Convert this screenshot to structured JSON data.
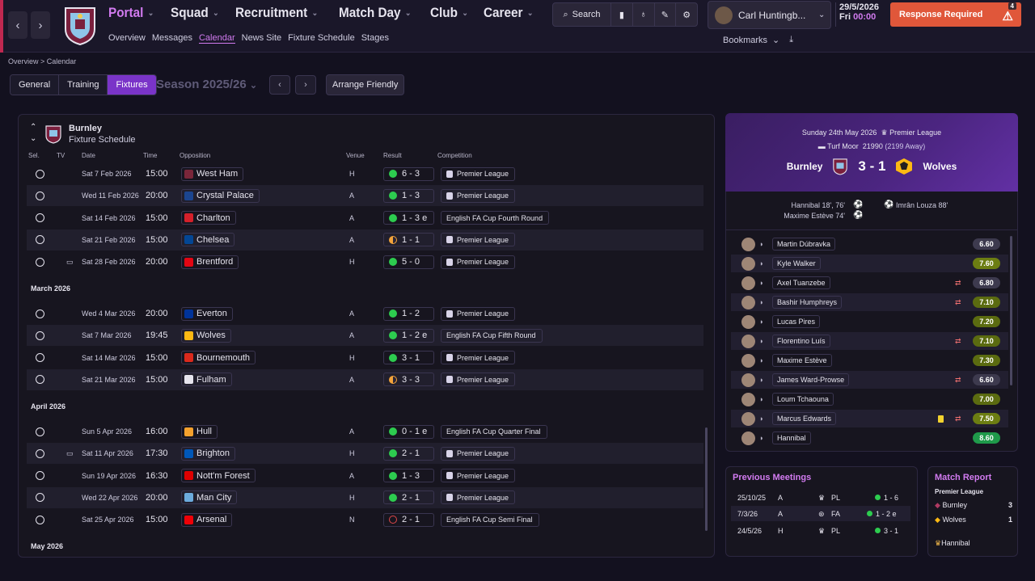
{
  "nav": {
    "back": "‹",
    "forward": "›"
  },
  "menu": [
    {
      "label": "Portal",
      "active": true
    },
    {
      "label": "Squad"
    },
    {
      "label": "Recruitment"
    },
    {
      "label": "Match Day"
    },
    {
      "label": "Club"
    },
    {
      "label": "Career"
    }
  ],
  "submenu": [
    "Overview",
    "Messages",
    "Calendar",
    "News Site",
    "Fixture Schedule",
    "Stages"
  ],
  "search": {
    "label": "Search"
  },
  "manager": {
    "name": "Carl Huntingb..."
  },
  "game_date": {
    "date": "29/5/2026",
    "day": "Fri",
    "time": "00:00"
  },
  "response": {
    "label": "Response Required",
    "count": "4"
  },
  "bookmarks": {
    "label": "Bookmarks"
  },
  "breadcrumb": "Overview  >  Calendar",
  "tabs": [
    "General",
    "Training",
    "Fixtures"
  ],
  "season": "Season 2025/26",
  "arrange_friendly": "Arrange Friendly",
  "schedule": {
    "team": "Burnley",
    "subtitle": "Fixture Schedule",
    "columns": {
      "sel": "Sel.",
      "tv": "TV",
      "date": "Date",
      "time": "Time",
      "opposition": "Opposition",
      "venue": "Venue",
      "result": "Result",
      "competition": "Competition"
    },
    "months": {
      "march": "March 2026",
      "april": "April 2026",
      "may": "May 2026"
    },
    "feb": [
      {
        "date": "Sat 7 Feb 2026",
        "time": "15:00",
        "opp": "West Ham",
        "badge": "#7a263a",
        "venue": "H",
        "result": "6 - 3",
        "dot": "win",
        "comp": "Premier League",
        "tv": ""
      },
      {
        "date": "Wed 11 Feb 2026",
        "time": "20:00",
        "opp": "Crystal Palace",
        "badge": "#1b458f",
        "venue": "A",
        "result": "1 - 3",
        "dot": "win",
        "comp": "Premier League",
        "tv": ""
      },
      {
        "date": "Sat 14 Feb 2026",
        "time": "15:00",
        "opp": "Charlton",
        "badge": "#d4202a",
        "venue": "A",
        "result": "1 - 3 e",
        "dot": "win",
        "comp": "English FA Cup Fourth Round",
        "tv": ""
      },
      {
        "date": "Sat 21 Feb 2026",
        "time": "15:00",
        "opp": "Chelsea",
        "badge": "#034694",
        "venue": "A",
        "result": "1 - 1",
        "dot": "draw",
        "comp": "Premier League",
        "tv": ""
      },
      {
        "date": "Sat 28 Feb 2026",
        "time": "20:00",
        "opp": "Brentford",
        "badge": "#e30613",
        "venue": "H",
        "result": "5 - 0",
        "dot": "win",
        "comp": "Premier League",
        "tv": "tv"
      }
    ],
    "mar": [
      {
        "date": "Wed 4 Mar 2026",
        "time": "20:00",
        "opp": "Everton",
        "badge": "#003399",
        "venue": "A",
        "result": "1 - 2",
        "dot": "win",
        "comp": "Premier League",
        "tv": ""
      },
      {
        "date": "Sat 7 Mar 2026",
        "time": "19:45",
        "opp": "Wolves",
        "badge": "#fdb913",
        "venue": "A",
        "result": "1 - 2 e",
        "dot": "win",
        "comp": "English FA Cup Fifth Round",
        "tv": ""
      },
      {
        "date": "Sat 14 Mar 2026",
        "time": "15:00",
        "opp": "Bournemouth",
        "badge": "#da291c",
        "venue": "H",
        "result": "3 - 1",
        "dot": "win",
        "comp": "Premier League",
        "tv": ""
      },
      {
        "date": "Sat 21 Mar 2026",
        "time": "15:00",
        "opp": "Fulham",
        "badge": "#e6e4ee",
        "venue": "A",
        "result": "3 - 3",
        "dot": "draw",
        "comp": "Premier League",
        "tv": ""
      }
    ],
    "apr": [
      {
        "date": "Sun 5 Apr 2026",
        "time": "16:00",
        "opp": "Hull",
        "badge": "#f5a12d",
        "venue": "A",
        "result": "0 - 1 e",
        "dot": "win",
        "comp": "English FA Cup Quarter Final",
        "tv": ""
      },
      {
        "date": "Sat 11 Apr 2026",
        "time": "17:30",
        "opp": "Brighton",
        "badge": "#0057b8",
        "venue": "H",
        "result": "2 - 1",
        "dot": "win",
        "comp": "Premier League",
        "tv": "tv"
      },
      {
        "date": "Sun 19 Apr 2026",
        "time": "16:30",
        "opp": "Nott'm Forest",
        "badge": "#dd0000",
        "venue": "A",
        "result": "1 - 3",
        "dot": "win",
        "comp": "Premier League",
        "tv": ""
      },
      {
        "date": "Wed 22 Apr 2026",
        "time": "20:00",
        "opp": "Man City",
        "badge": "#6cabdd",
        "venue": "H",
        "result": "2 - 1",
        "dot": "win",
        "comp": "Premier League",
        "tv": ""
      },
      {
        "date": "Sat 25 Apr 2026",
        "time": "15:00",
        "opp": "Arsenal",
        "badge": "#ef0107",
        "venue": "N",
        "result": "2 - 1",
        "dot": "loss",
        "comp": "English FA Cup Semi Final",
        "tv": ""
      }
    ]
  },
  "match": {
    "date": "Sunday 24th May 2026",
    "competition": "Premier League",
    "stadium": "Turf Moor",
    "attendance": "21990",
    "away_att": "(2199 Away)",
    "home": "Burnley",
    "away": "Wolves",
    "score": "3 - 1",
    "home_scorers": [
      "Hannibal 18', 76'",
      "Maxime Estève 74'"
    ],
    "away_scorers": [
      "Imrân Louza 88'"
    ]
  },
  "lineup": [
    {
      "name": "Martin Dúbravka",
      "rating": "6.60",
      "color": "#3d3a4e",
      "sub": "",
      "card": false
    },
    {
      "name": "Kyle Walker",
      "rating": "7.60",
      "color": "#6c7d12",
      "sub": "",
      "card": false
    },
    {
      "name": "Axel Tuanzebe",
      "rating": "6.80",
      "color": "#3d3a4e",
      "sub": "⇄",
      "card": false
    },
    {
      "name": "Bashir Humphreys",
      "rating": "7.10",
      "color": "#5b6b10",
      "sub": "⇄",
      "card": false
    },
    {
      "name": "Lucas Pires",
      "rating": "7.20",
      "color": "#5b6b10",
      "sub": "",
      "card": false
    },
    {
      "name": "Florentino Luís",
      "rating": "7.10",
      "color": "#5b6b10",
      "sub": "⇄",
      "card": false
    },
    {
      "name": "Maxime Estève",
      "rating": "7.30",
      "color": "#5b6b10",
      "sub": "",
      "card": false
    },
    {
      "name": "James Ward-Prowse",
      "rating": "6.60",
      "color": "#3d3a4e",
      "sub": "⇄",
      "card": false
    },
    {
      "name": "Loum Tchaouna",
      "rating": "7.00",
      "color": "#5b6b10",
      "sub": "",
      "card": false
    },
    {
      "name": "Marcus Edwards",
      "rating": "7.50",
      "color": "#6c7d12",
      "sub": "⇄",
      "card": true
    },
    {
      "name": "Hannibal",
      "rating": "8.60",
      "color": "#1f9a4a",
      "sub": "",
      "card": false
    }
  ],
  "previous_meetings": {
    "title": "Previous Meetings",
    "rows": [
      {
        "date": "25/10/25",
        "venue": "A",
        "comp": "PL",
        "result": "1 - 6"
      },
      {
        "date": "7/3/26",
        "venue": "A",
        "comp": "FA",
        "result": "1 - 2 e"
      },
      {
        "date": "24/5/26",
        "venue": "H",
        "comp": "PL",
        "result": "3 - 1"
      }
    ]
  },
  "match_report": {
    "title": "Match Report",
    "competition": "Premier League",
    "home": "Burnley",
    "home_score": "3",
    "away": "Wolves",
    "away_score": "1",
    "pom": "Hannibal"
  }
}
